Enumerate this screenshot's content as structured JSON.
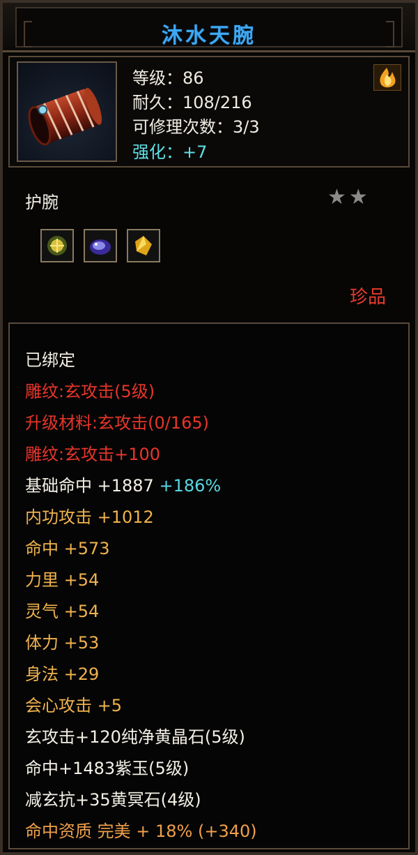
{
  "title": "沐水天腕",
  "header": {
    "level": "等级：86",
    "durability": "耐久：108/216",
    "repairs": "可修理次数：3/3",
    "enhance": "强化：+7"
  },
  "item_type": "护腕",
  "stars": "★★",
  "rarity": "珍品",
  "attributes": {
    "bound": "已绑定",
    "engrave1": "雕纹:玄攻击(5级)",
    "upgrade": "升级材料:玄攻击(0/165)",
    "engrave2": "雕纹:玄攻击+100",
    "base_hit": "基础命中  +1887",
    "base_hit_pct": "+186%",
    "inner_attack": "内功攻击  +1012",
    "hit": "命中  +573",
    "strength": "力里  +54",
    "spirit": "灵气  +54",
    "stamina": "体力  +53",
    "agility": "身法  +29",
    "crit": "会心攻击  +5",
    "gem1": "玄攻击+120纯净黄晶石(5级)",
    "gem2": "命中+1483紫玉(5级)",
    "gem3": "减玄抗+35黄冥石(4级)",
    "aptitude": "命中资质  完美  + 18% (+340)"
  },
  "icons": {
    "item": "bracer-icon",
    "fire": "fire-icon",
    "gems": [
      "yellow-gem-icon",
      "purple-gem-icon",
      "gold-gem-icon"
    ]
  }
}
